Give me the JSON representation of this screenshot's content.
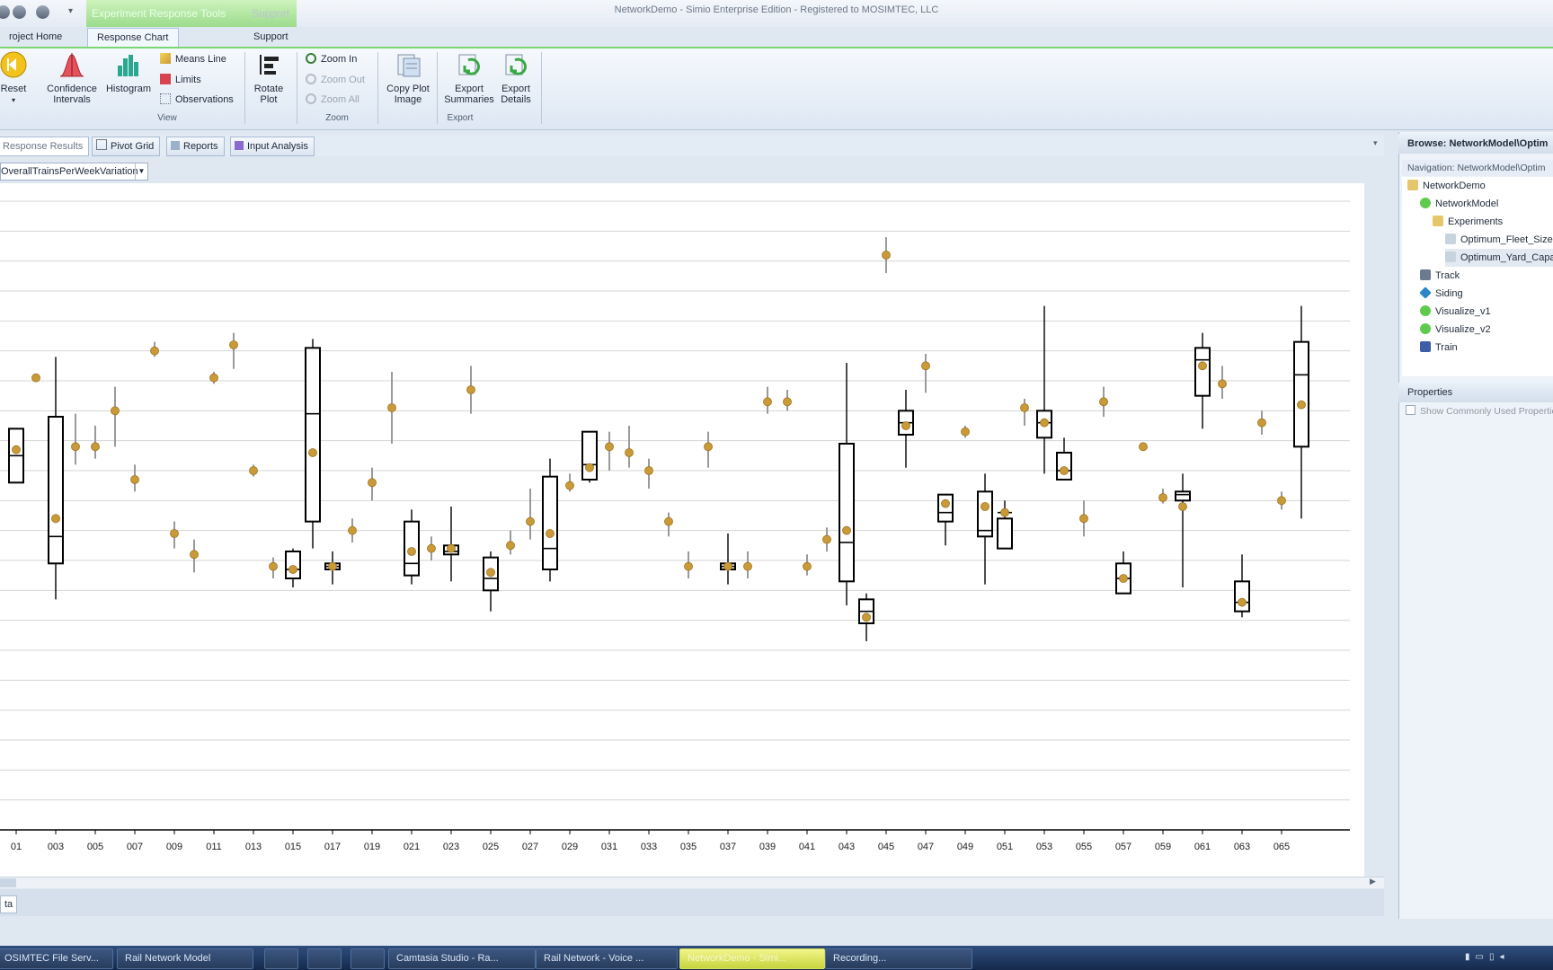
{
  "window": {
    "title": "NetworkDemo - Simio Enterprise Edition - Registered to MOSIMTEC, LLC",
    "contextual_group": "Experiment Response Tools",
    "top_support": "Support"
  },
  "ribbon_tabs": [
    "roject Home",
    "Response Chart",
    "Support"
  ],
  "ribbon": {
    "reset": "Reset",
    "conf1": "Confidence",
    "conf2": "Intervals",
    "histogram": "Histogram",
    "means_line": "Means Line",
    "limits": "Limits",
    "observations": "Observations",
    "view_group": "View",
    "rotate1": "Rotate",
    "rotate2": "Plot",
    "zoom_in": "Zoom In",
    "zoom_out": "Zoom Out",
    "zoom_all": "Zoom All",
    "zoom_group": "Zoom",
    "copy1": "Copy Plot",
    "copy2": "Image",
    "export_sum1": "Export",
    "export_sum2": "Summaries",
    "export_det1": "Export",
    "export_det2": "Details",
    "export_group": "Export"
  },
  "doc_tabs": [
    "Response Results",
    "Pivot Grid",
    "Reports",
    "Input Analysis"
  ],
  "response_selector": "OverallTrainsPerWeekVariation",
  "chart_data": {
    "type": "box",
    "title": "",
    "x_labels": [
      "01",
      "003",
      "005",
      "007",
      "009",
      "011",
      "013",
      "015",
      "017",
      "019",
      "021",
      "023",
      "025",
      "027",
      "029",
      "031",
      "033",
      "035",
      "037",
      "039",
      "041",
      "043",
      "045",
      "047",
      "049",
      "051",
      "053",
      "055",
      "057",
      "059",
      "061",
      "063",
      "065"
    ],
    "y_range": [
      0,
      21
    ],
    "grid": true,
    "boxes": [
      {
        "s": 1,
        "mean": 12.7,
        "q1": 11.6,
        "q3": 13.4,
        "median": 12.5,
        "lo": 11.6,
        "hi": 13.4
      },
      {
        "s": 2,
        "mean": 15.1
      },
      {
        "s": 3,
        "mean": 10.4,
        "q1": 8.9,
        "q3": 13.8,
        "median": 9.8,
        "lo": 7.7,
        "hi": 15.8
      },
      {
        "s": 4,
        "mean": 12.8,
        "lo": 12.2,
        "hi": 13.9
      },
      {
        "s": 5,
        "mean": 12.8,
        "lo": 12.4,
        "hi": 13.5
      },
      {
        "s": 6,
        "mean": 14.0,
        "lo": 12.8,
        "hi": 14.8
      },
      {
        "s": 7,
        "mean": 11.7,
        "lo": 11.3,
        "hi": 12.2
      },
      {
        "s": 8,
        "mean": 16.0,
        "lo": 15.8,
        "hi": 16.3
      },
      {
        "s": 9,
        "mean": 9.9,
        "lo": 9.4,
        "hi": 10.3
      },
      {
        "s": 10,
        "mean": 9.2,
        "lo": 8.6,
        "hi": 9.7
      },
      {
        "s": 11,
        "mean": 15.1,
        "lo": 14.9,
        "hi": 15.3
      },
      {
        "s": 12,
        "mean": 16.2,
        "lo": 15.4,
        "hi": 16.6
      },
      {
        "s": 13,
        "mean": 12.0,
        "lo": 11.8,
        "hi": 12.2
      },
      {
        "s": 14,
        "mean": 8.8,
        "lo": 8.4,
        "hi": 9.1
      },
      {
        "s": 15,
        "mean": 8.7,
        "q1": 8.4,
        "q3": 9.3,
        "median": 8.7,
        "lo": 8.1,
        "hi": 9.4
      },
      {
        "s": 16,
        "mean": 12.6,
        "q1": 10.3,
        "q3": 16.1,
        "median": 13.9,
        "lo": 9.4,
        "hi": 16.4
      },
      {
        "s": 17,
        "mean": 8.8,
        "q1": 8.7,
        "q3": 8.9,
        "median": 8.8,
        "lo": 8.2,
        "hi": 9.3
      },
      {
        "s": 18,
        "mean": 10.0,
        "lo": 9.6,
        "hi": 10.4
      },
      {
        "s": 19,
        "mean": 11.6,
        "lo": 11.0,
        "hi": 12.1
      },
      {
        "s": 20,
        "mean": 14.1,
        "lo": 12.9,
        "hi": 15.3
      },
      {
        "s": 21,
        "mean": 9.3,
        "q1": 8.5,
        "q3": 10.3,
        "median": 8.9,
        "lo": 8.2,
        "hi": 10.7
      },
      {
        "s": 22,
        "mean": 9.4,
        "lo": 9.0,
        "hi": 9.8
      },
      {
        "s": 23,
        "mean": 9.4,
        "q1": 9.2,
        "q3": 9.5,
        "median": 9.3,
        "lo": 8.3,
        "hi": 10.8
      },
      {
        "s": 24,
        "mean": 14.7,
        "lo": 13.9,
        "hi": 15.5
      },
      {
        "s": 25,
        "mean": 8.6,
        "q1": 8.0,
        "q3": 9.1,
        "median": 8.4,
        "lo": 7.3,
        "hi": 9.3
      },
      {
        "s": 26,
        "mean": 9.5,
        "lo": 9.2,
        "hi": 10.0
      },
      {
        "s": 27,
        "mean": 10.3,
        "lo": 9.7,
        "hi": 11.4
      },
      {
        "s": 28,
        "mean": 9.9,
        "q1": 8.7,
        "q3": 11.8,
        "median": 9.4,
        "lo": 8.3,
        "hi": 12.4
      },
      {
        "s": 29,
        "mean": 11.5,
        "lo": 11.3,
        "hi": 11.9
      },
      {
        "s": 30,
        "mean": 12.1,
        "q1": 11.7,
        "q3": 13.3,
        "median": 12.2,
        "lo": 11.6,
        "hi": 13.3
      },
      {
        "s": 31,
        "mean": 12.8,
        "lo": 12.0,
        "hi": 13.3
      },
      {
        "s": 32,
        "mean": 12.6,
        "lo": 12.1,
        "hi": 13.5
      },
      {
        "s": 33,
        "mean": 12.0,
        "lo": 11.4,
        "hi": 12.4
      },
      {
        "s": 34,
        "mean": 10.3,
        "lo": 9.8,
        "hi": 10.6
      },
      {
        "s": 35,
        "mean": 8.8,
        "lo": 8.4,
        "hi": 9.3
      },
      {
        "s": 36,
        "mean": 12.8,
        "lo": 12.1,
        "hi": 13.3
      },
      {
        "s": 37,
        "mean": 8.8,
        "q1": 8.7,
        "q3": 8.9,
        "median": 8.8,
        "lo": 8.2,
        "hi": 9.9
      },
      {
        "s": 38,
        "mean": 8.8,
        "lo": 8.4,
        "hi": 9.3
      },
      {
        "s": 39,
        "mean": 14.3,
        "lo": 13.9,
        "hi": 14.8
      },
      {
        "s": 40,
        "mean": 14.3,
        "lo": 14.0,
        "hi": 14.7
      },
      {
        "s": 41,
        "mean": 8.8,
        "lo": 8.5,
        "hi": 9.2
      },
      {
        "s": 42,
        "mean": 9.7,
        "lo": 9.3,
        "hi": 10.1
      },
      {
        "s": 43,
        "mean": 10.0,
        "q1": 8.3,
        "q3": 12.9,
        "median": 9.6,
        "lo": 7.5,
        "hi": 15.6
      },
      {
        "s": 44,
        "mean": 7.1,
        "q1": 6.9,
        "q3": 7.7,
        "median": 7.3,
        "lo": 6.3,
        "hi": 7.9
      },
      {
        "s": 45,
        "mean": 19.2,
        "lo": 18.6,
        "hi": 19.8
      },
      {
        "s": 46,
        "mean": 13.5,
        "q1": 13.2,
        "q3": 14.0,
        "median": 13.6,
        "lo": 12.1,
        "hi": 14.7
      },
      {
        "s": 47,
        "mean": 15.5,
        "lo": 14.6,
        "hi": 15.9
      },
      {
        "s": 48,
        "mean": 10.9,
        "q1": 10.3,
        "q3": 11.2,
        "median": 10.6,
        "lo": 9.5,
        "hi": 11.2
      },
      {
        "s": 49,
        "mean": 13.3,
        "lo": 13.1,
        "hi": 13.5
      },
      {
        "s": 50,
        "mean": 10.8,
        "q1": 9.8,
        "q3": 11.3,
        "median": 10.0,
        "lo": 8.2,
        "hi": 11.9
      },
      {
        "s": 51,
        "mean": 10.6,
        "q1": 9.4,
        "q3": 10.4,
        "median": 10.6,
        "lo": 9.4,
        "hi": 11.0
      },
      {
        "s": 52,
        "mean": 14.1,
        "lo": 13.5,
        "hi": 14.4
      },
      {
        "s": 53,
        "mean": 13.6,
        "q1": 13.1,
        "q3": 14.0,
        "median": 13.6,
        "lo": 11.9,
        "hi": 17.5
      },
      {
        "s": 54,
        "mean": 12.0,
        "q1": 11.7,
        "q3": 12.6,
        "median": 12.0,
        "lo": 11.7,
        "hi": 13.1
      },
      {
        "s": 55,
        "mean": 10.4,
        "lo": 9.8,
        "hi": 11.0
      },
      {
        "s": 56,
        "mean": 14.3,
        "lo": 13.8,
        "hi": 14.8
      },
      {
        "s": 57,
        "mean": 8.4,
        "q1": 7.9,
        "q3": 8.9,
        "median": 8.4,
        "lo": 7.9,
        "hi": 9.3
      },
      {
        "s": 58,
        "mean": 12.8,
        "lo": 12.7,
        "hi": 12.9
      },
      {
        "s": 59,
        "mean": 11.1,
        "lo": 10.9,
        "hi": 11.4
      },
      {
        "s": 60,
        "mean": 10.8,
        "q1": 11.0,
        "q3": 11.3,
        "median": 11.2,
        "lo": 8.1,
        "hi": 11.9
      },
      {
        "s": 61,
        "mean": 15.5,
        "q1": 14.5,
        "q3": 16.1,
        "median": 15.7,
        "lo": 13.4,
        "hi": 16.6
      },
      {
        "s": 62,
        "mean": 14.9,
        "lo": 14.4,
        "hi": 15.5
      },
      {
        "s": 63,
        "mean": 7.6,
        "q1": 7.3,
        "q3": 8.3,
        "median": 7.6,
        "lo": 7.1,
        "hi": 9.2
      },
      {
        "s": 64,
        "mean": 13.6,
        "lo": 13.2,
        "hi": 14.0
      },
      {
        "s": 65,
        "mean": 11.0,
        "lo": 10.7,
        "hi": 11.3
      },
      {
        "s": 66,
        "mean": 14.2,
        "q1": 12.8,
        "q3": 16.3,
        "median": 15.2,
        "lo": 10.4,
        "hi": 17.5
      }
    ],
    "colors": {
      "mean": "#c99a36",
      "box": "#000000",
      "ci_whisker": "#9a9a9a",
      "grid": "#d4d4d4"
    }
  },
  "right_panel": {
    "browse": "Browse: NetworkModel\\Optim",
    "navigation": "Navigation: NetworkModel\\Optim",
    "tree": [
      {
        "label": "NetworkDemo",
        "icon": "folder-icon",
        "indent": 0
      },
      {
        "label": "NetworkModel",
        "icon": "model-icon",
        "indent": 1
      },
      {
        "label": "Experiments",
        "icon": "folder-icon",
        "indent": 2
      },
      {
        "label": "Optimum_Fleet_Sizes",
        "icon": "table-icon",
        "indent": 3
      },
      {
        "label": "Optimum_Yard_Capa",
        "icon": "table-icon",
        "indent": 3
      },
      {
        "label": "Track",
        "icon": "track-icon",
        "indent": 1
      },
      {
        "label": "Siding",
        "icon": "diamond-icon",
        "indent": 1
      },
      {
        "label": "Visualize_v1",
        "icon": "model-icon",
        "indent": 1
      },
      {
        "label": "Visualize_v2",
        "icon": "model-icon",
        "indent": 1
      },
      {
        "label": "Train",
        "icon": "train-icon",
        "indent": 1
      }
    ],
    "properties": "Properties",
    "show_common": "Show Commonly Used Propertie"
  },
  "bottom_tab": "ta",
  "taskbar": [
    "OSIMTEC File Serv...",
    "Rail Network Model",
    "Camtasia Studio - Ra...",
    "Rail Network - Voice ...",
    "NetworkDemo - Simi...",
    "Recording..."
  ]
}
